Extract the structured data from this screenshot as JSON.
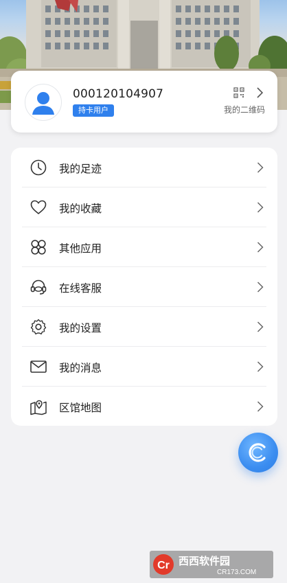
{
  "profile": {
    "user_id": "000120104907",
    "badge": "持卡用户",
    "qr_label": "我的二维码"
  },
  "menu": {
    "items": [
      {
        "label": "我的足迹",
        "icon": "clock-icon"
      },
      {
        "label": "我的收藏",
        "icon": "heart-icon"
      },
      {
        "label": "其他应用",
        "icon": "apps-icon"
      },
      {
        "label": "在线客服",
        "icon": "headset-icon"
      },
      {
        "label": "我的设置",
        "icon": "gear-icon"
      },
      {
        "label": "我的消息",
        "icon": "envelope-icon"
      },
      {
        "label": "区馆地图",
        "icon": "map-pin-icon"
      }
    ]
  },
  "watermark": {
    "brand": "西西软件园",
    "domain": "CR173.COM"
  },
  "colors": {
    "accent": "#2f80ed",
    "background": "#f2f2f4",
    "card": "#ffffff"
  }
}
